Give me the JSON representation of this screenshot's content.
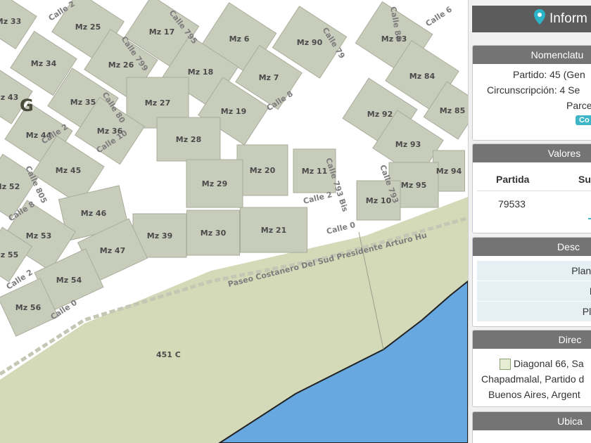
{
  "map": {
    "manzanas": [
      "Mz 33",
      "Mz 25",
      "Mz 17",
      "Mz 6",
      "Mz 90",
      "Mz 83",
      "Mz 34",
      "Mz 26",
      "Mz 18",
      "Mz 7",
      "Mz 84",
      "Mz 43",
      "Mz 35",
      "Mz 27",
      "Mz 19",
      "Mz 92",
      "Mz 85",
      "Mz 44",
      "Mz 36",
      "Mz 28",
      "Mz 93",
      "Mz 45",
      "Mz 20",
      "Mz 11",
      "Mz 94",
      "Mz 52",
      "Mz 29",
      "Mz 95",
      "Mz 46",
      "Mz 10",
      "Mz 53",
      "Mz 30",
      "Mz 21",
      "Mz 39",
      "Mz 47",
      "Mz 55",
      "Mz 54",
      "Mz 56"
    ],
    "streets": [
      "Calle 2",
      "Calle 795",
      "Calle 799",
      "Calle 79",
      "Calle 6",
      "Calle 89",
      "Calle 80",
      "Calle 8",
      "Calle 10",
      "Calle 2",
      "Calle 805",
      "Calle 793 Bis",
      "Calle 793",
      "Calle 0",
      "Calle 8",
      "Calle 2",
      "Calle 0",
      "Calle 2"
    ],
    "paseo": "Paseo Costanero Del Sud Presidente Arturo Hu",
    "parcel_label": "451 C",
    "zone_letter": "G",
    "colors": {
      "block": "#c8ccbb",
      "road": "#ffffff",
      "park": "#d4dab8",
      "sea": "#67a8e0",
      "coast": "#222222"
    }
  },
  "panel": {
    "header": "Inform",
    "pin_icon": "map-pin-icon",
    "nomenclatura": {
      "title": "Nomenclatu",
      "partido": "Partido: 45 (Gen",
      "circunscripcion": "Circunscripción: 4 Se",
      "parcela": "Parce",
      "badge": "Co"
    },
    "valores": {
      "title": "Valores",
      "col_partida": "Partida",
      "col_su": "Su",
      "partida_value": "79533"
    },
    "descripcion": {
      "title": "Desc",
      "rows": [
        "Plano",
        "D",
        "Pla"
      ]
    },
    "direccion": {
      "title": "Direc",
      "lines": [
        "Diagonal 66, Sa",
        "Chapadmalal, Partido d",
        "Buenos Aires, Argent"
      ]
    },
    "ubicacion": {
      "title": "Ubica"
    }
  }
}
